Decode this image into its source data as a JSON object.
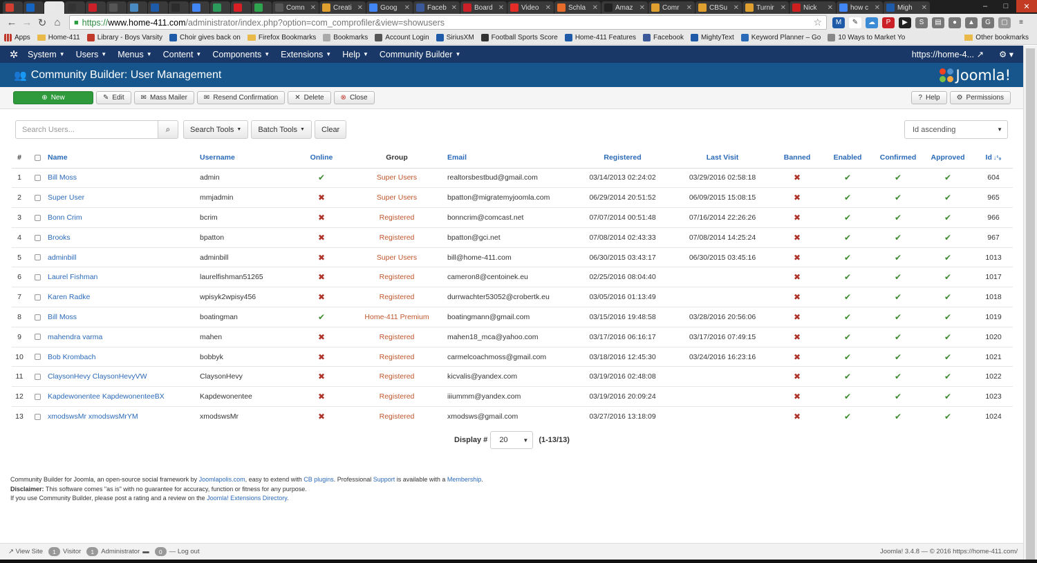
{
  "browser": {
    "tabs": [
      {
        "label": "",
        "color": "#d23f31"
      },
      {
        "label": "",
        "color": "#1565c0"
      },
      {
        "label": "",
        "color": "#e9e9e9",
        "active": true
      },
      {
        "label": "",
        "color": "#333"
      },
      {
        "label": "",
        "color": "#cb2027"
      },
      {
        "label": "",
        "color": "#555"
      },
      {
        "label": "",
        "color": "#4a8ac2"
      },
      {
        "label": "",
        "color": "#1e5aa8"
      },
      {
        "label": "",
        "color": "#2c2c2c"
      },
      {
        "label": "",
        "color": "#4285f4"
      },
      {
        "label": "",
        "color": "#2b9a5b"
      },
      {
        "label": "",
        "color": "#d81f26"
      },
      {
        "label": "",
        "color": "#2ea44f"
      },
      {
        "label": "Comn",
        "color": "#555"
      },
      {
        "label": "Creati",
        "color": "#e0a030"
      },
      {
        "label": "Goog",
        "color": "#4285f4"
      },
      {
        "label": "Faceb",
        "color": "#3b5998"
      },
      {
        "label": "Board",
        "color": "#cb2027"
      },
      {
        "label": "Video",
        "color": "#e52d27"
      },
      {
        "label": "Schla",
        "color": "#e66c2c"
      },
      {
        "label": "Amaz",
        "color": "#222"
      },
      {
        "label": "Comr",
        "color": "#e0a030"
      },
      {
        "label": "CBSu",
        "color": "#e0a030"
      },
      {
        "label": "Turnir",
        "color": "#e0a030"
      },
      {
        "label": "Nick",
        "color": "#cc1f1f"
      },
      {
        "label": "how c",
        "color": "#4285f4"
      },
      {
        "label": "Migh",
        "color": "#1e5aa8"
      }
    ],
    "url_scheme": "https://",
    "url_host": "www.home-411.com",
    "url_path": "/administrator/index.php?option=com_comprofiler&view=showusers",
    "bookmarks": [
      {
        "label": "Apps",
        "type": "apps"
      },
      {
        "label": "Home-411",
        "type": "folder"
      },
      {
        "label": "Library - Boys Varsity",
        "type": "icon",
        "color": "#c0392b"
      },
      {
        "label": "Choir gives back on",
        "type": "icon",
        "color": "#1e5aa8"
      },
      {
        "label": "Firefox Bookmarks",
        "type": "folder"
      },
      {
        "label": "Bookmarks",
        "type": "icon",
        "color": "#aaa"
      },
      {
        "label": "Account Login",
        "type": "icon",
        "color": "#555"
      },
      {
        "label": "SiriusXM",
        "type": "icon",
        "color": "#1e5aa8"
      },
      {
        "label": "Football Sports Score",
        "type": "icon",
        "color": "#333"
      },
      {
        "label": "Home-411 Features",
        "type": "icon",
        "color": "#1e5aa8"
      },
      {
        "label": "Facebook",
        "type": "icon",
        "color": "#3b5998"
      },
      {
        "label": "MightyText",
        "type": "icon",
        "color": "#1e5aa8"
      },
      {
        "label": "Keyword Planner – Go",
        "type": "icon",
        "color": "#2a69b8"
      },
      {
        "label": "10 Ways to Market Yo",
        "type": "icon",
        "color": "#888"
      }
    ],
    "other_bookmarks": "Other bookmarks"
  },
  "nav": {
    "items": [
      {
        "label": "System"
      },
      {
        "label": "Users"
      },
      {
        "label": "Menus"
      },
      {
        "label": "Content"
      },
      {
        "label": "Components"
      },
      {
        "label": "Extensions"
      },
      {
        "label": "Help"
      },
      {
        "label": "Community Builder"
      }
    ],
    "site_link": "https://home-4..."
  },
  "header": {
    "title": "Community Builder: User Management",
    "brand": "Joomla!"
  },
  "toolbar": {
    "new": "New",
    "edit": "Edit",
    "mass_mailer": "Mass Mailer",
    "resend": "Resend Confirmation",
    "delete": "Delete",
    "close": "Close",
    "help": "Help",
    "permissions": "Permissions"
  },
  "filters": {
    "search_placeholder": "Search Users...",
    "search_tools": "Search Tools",
    "batch_tools": "Batch Tools",
    "clear": "Clear",
    "ordering": "Id ascending"
  },
  "table": {
    "columns": {
      "num": "#",
      "name": "Name",
      "username": "Username",
      "online": "Online",
      "group": "Group",
      "email": "Email",
      "registered": "Registered",
      "last_visit": "Last Visit",
      "banned": "Banned",
      "enabled": "Enabled",
      "confirmed": "Confirmed",
      "approved": "Approved",
      "id": "Id"
    },
    "rows": [
      {
        "num": "1",
        "name": "Bill Moss",
        "username": "admin",
        "online": true,
        "group": "Super Users",
        "email": "realtorsbestbud@gmail.com",
        "registered": "03/14/2013 02:24:02",
        "last_visit": "03/29/2016 02:58:18",
        "id": "604"
      },
      {
        "num": "2",
        "name": "Super User",
        "username": "mmjadmin",
        "online": false,
        "group": "Super Users",
        "email": "bpatton@migratemyjoomla.com",
        "registered": "06/29/2014 20:51:52",
        "last_visit": "06/09/2015 15:08:15",
        "id": "965"
      },
      {
        "num": "3",
        "name": "Bonn Crim",
        "username": "bcrim",
        "online": false,
        "group": "Registered",
        "email": "bonncrim@comcast.net",
        "registered": "07/07/2014 00:51:48",
        "last_visit": "07/16/2014 22:26:26",
        "id": "966"
      },
      {
        "num": "4",
        "name": "Brooks",
        "username": "bpatton",
        "online": false,
        "group": "Registered",
        "email": "bpatton@gci.net",
        "registered": "07/08/2014 02:43:33",
        "last_visit": "07/08/2014 14:25:24",
        "id": "967"
      },
      {
        "num": "5",
        "name": "adminbill",
        "username": "adminbill",
        "online": false,
        "group": "Super Users",
        "email": "bill@home-411.com",
        "registered": "06/30/2015 03:43:17",
        "last_visit": "06/30/2015 03:45:16",
        "id": "1013"
      },
      {
        "num": "6",
        "name": "Laurel Fishman",
        "username": "laurelfishman51265",
        "online": false,
        "group": "Registered",
        "email": "cameron8@centoinek.eu",
        "registered": "02/25/2016 08:04:40",
        "last_visit": "",
        "id": "1017"
      },
      {
        "num": "7",
        "name": "Karen Radke",
        "username": "wpisyk2wpisy456",
        "online": false,
        "group": "Registered",
        "email": "durrwachter53052@crobertk.eu",
        "registered": "03/05/2016 01:13:49",
        "last_visit": "",
        "id": "1018"
      },
      {
        "num": "8",
        "name": "Bill Moss",
        "username": "boatingman",
        "online": true,
        "group": "Home-411 Premium",
        "email": "boatingmann@gmail.com",
        "registered": "03/15/2016 19:48:58",
        "last_visit": "03/28/2016 20:56:06",
        "id": "1019"
      },
      {
        "num": "9",
        "name": "mahendra varma",
        "username": "mahen",
        "online": false,
        "group": "Registered",
        "email": "mahen18_mca@yahoo.com",
        "registered": "03/17/2016 06:16:17",
        "last_visit": "03/17/2016 07:49:15",
        "id": "1020"
      },
      {
        "num": "10",
        "name": "Bob Krombach",
        "username": "bobbyk",
        "online": false,
        "group": "Registered",
        "email": "carmelcoachmoss@gmail.com",
        "registered": "03/18/2016 12:45:30",
        "last_visit": "03/24/2016 16:23:16",
        "id": "1021"
      },
      {
        "num": "11",
        "name": "ClaysonHevy ClaysonHevyVW",
        "username": "ClaysonHevy",
        "online": false,
        "group": "Registered",
        "email": "kicvalis@yandex.com",
        "registered": "03/19/2016 02:48:08",
        "last_visit": "",
        "id": "1022"
      },
      {
        "num": "12",
        "name": "Kapdewonentee KapdewonenteeBX",
        "username": "Kapdewonentee",
        "online": false,
        "group": "Registered",
        "email": "iiiummm@yandex.com",
        "registered": "03/19/2016 20:09:24",
        "last_visit": "",
        "id": "1023"
      },
      {
        "num": "13",
        "name": "xmodswsMr xmodswsMrYM",
        "username": "xmodswsMr",
        "online": false,
        "group": "Registered",
        "email": "xmodsws@gmail.com",
        "registered": "03/27/2016 13:18:09",
        "last_visit": "",
        "id": "1024"
      }
    ]
  },
  "pager": {
    "label": "Display #",
    "value": "20",
    "range": "(1-13/13)"
  },
  "notes": {
    "l1_a": "Community Builder for Joomla, an open-source social framework by ",
    "l1_link1": "Joomlapolis.com",
    "l1_b": ", easy to extend with ",
    "l1_link2": "CB plugins",
    "l1_c": ". Professional ",
    "l1_link3": "Support",
    "l1_d": " is available with a ",
    "l1_link4": "Membership",
    "l1_e": ".",
    "l2_bold": "Disclaimer:",
    "l2": " This software comes \"as is\" with no guarantee for accuracy, function or fitness for any purpose.",
    "l3_a": "If you use Community Builder, please post a rating and a review on the ",
    "l3_link": "Joomla! Extensions Directory",
    "l3_b": "."
  },
  "status": {
    "view_site": "View Site",
    "visitor_count": "1",
    "visitor": "Visitor",
    "admin_count": "1",
    "admin": "Administrator",
    "msg_count": "0",
    "logout": "Log out",
    "version": "Joomla! 3.4.8 — © 2016 https://home-411.com/"
  }
}
